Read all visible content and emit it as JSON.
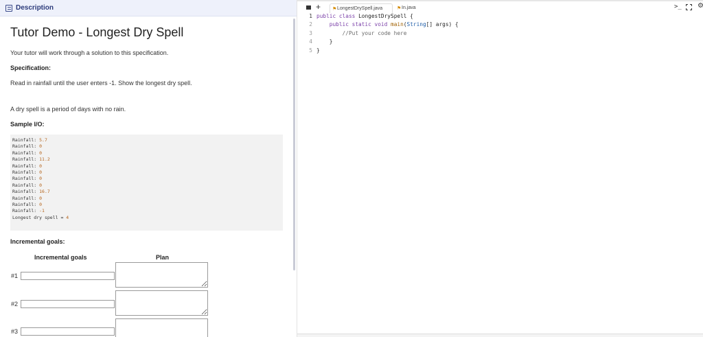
{
  "left": {
    "tab_label": "Description",
    "title": "Tutor Demo - Longest Dry Spell",
    "intro": "Your tutor will work through a solution to this specification.",
    "spec_heading": "Specification:",
    "spec_text": "Read in rainfall until the user enters -1. Show the longest dry spell.",
    "dry_def": "A dry spell is a period of days with no rain.",
    "sample_heading": "Sample I/O:",
    "sample_lines": [
      {
        "label": "Rainfall: ",
        "value": "5.7"
      },
      {
        "label": "Rainfall: ",
        "value": "0"
      },
      {
        "label": "Rainfall: ",
        "value": "0"
      },
      {
        "label": "Rainfall: ",
        "value": "11.2"
      },
      {
        "label": "Rainfall: ",
        "value": "0"
      },
      {
        "label": "Rainfall: ",
        "value": "0"
      },
      {
        "label": "Rainfall: ",
        "value": "0"
      },
      {
        "label": "Rainfall: ",
        "value": "0"
      },
      {
        "label": "Rainfall: ",
        "value": "16.7"
      },
      {
        "label": "Rainfall: ",
        "value": "0"
      },
      {
        "label": "Rainfall: ",
        "value": "0"
      },
      {
        "label": "Rainfall: ",
        "value": "-1"
      },
      {
        "label": "Longest dry spell = ",
        "value": "4"
      }
    ],
    "goals_heading": "Incremental goals:",
    "col_goals": "Incremental goals",
    "col_plan": "Plan",
    "rows": [
      {
        "num": "#1",
        "goal": "",
        "plan": ""
      },
      {
        "num": "#2",
        "goal": "",
        "plan": ""
      },
      {
        "num": "#3",
        "goal": "",
        "plan": ""
      }
    ]
  },
  "right": {
    "tabs": [
      {
        "label": "LongestDrySpell.java",
        "icon": "java-file-icon"
      },
      {
        "label": "In.java",
        "icon": "java-file-icon"
      }
    ],
    "terminal_label": ">_",
    "code": [
      {
        "n": "1",
        "text": "public class LongestDrySpell {"
      },
      {
        "n": "2",
        "text": "    public static void main(String[] args) {"
      },
      {
        "n": "3",
        "text": "        //Put your code here"
      },
      {
        "n": "4",
        "text": "    }"
      },
      {
        "n": "5",
        "text": "}"
      }
    ]
  }
}
